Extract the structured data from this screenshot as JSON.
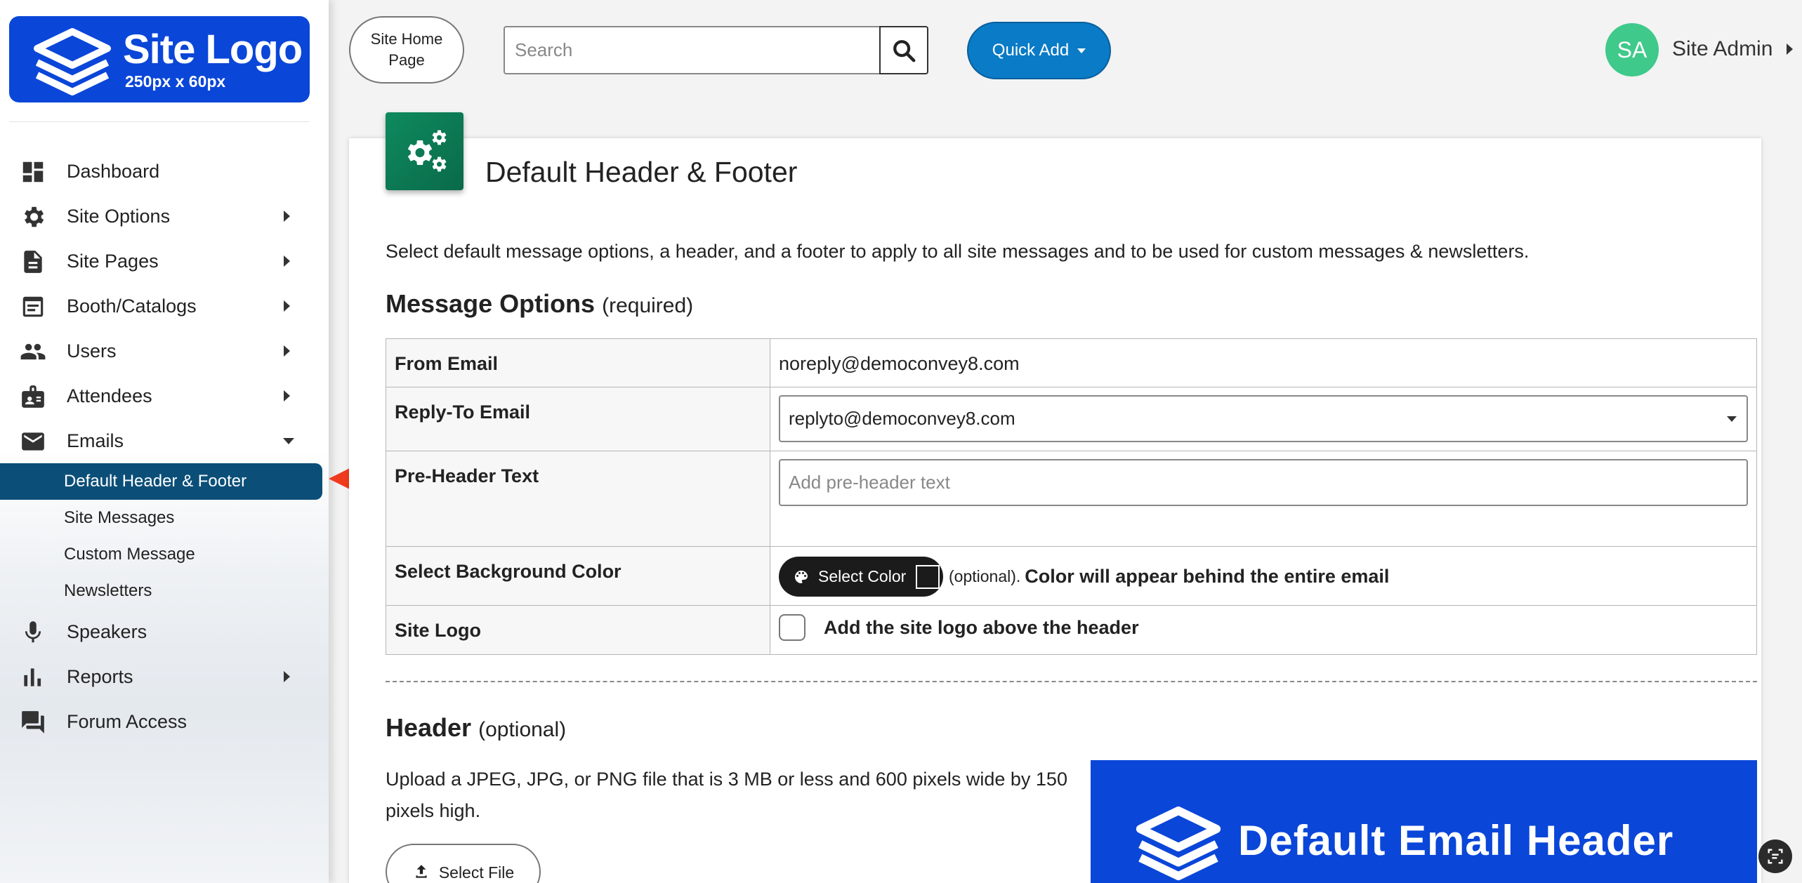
{
  "sidebar": {
    "logo": {
      "title": "Site Logo",
      "subtitle": "250px x 60px"
    },
    "items": [
      {
        "label": "Dashboard",
        "icon": "dashboard-icon"
      },
      {
        "label": "Site Options",
        "icon": "gear-icon"
      },
      {
        "label": "Site Pages",
        "icon": "document-icon"
      },
      {
        "label": "Booth/Catalogs",
        "icon": "catalog-icon"
      },
      {
        "label": "Users",
        "icon": "users-icon"
      },
      {
        "label": "Attendees",
        "icon": "badge-icon"
      },
      {
        "label": "Emails",
        "icon": "mail-icon"
      },
      {
        "label": "Speakers",
        "icon": "microphone-icon"
      },
      {
        "label": "Reports",
        "icon": "bar-chart-icon"
      },
      {
        "label": "Forum Access",
        "icon": "forum-icon"
      }
    ],
    "email_sub": [
      {
        "label": "Default Header & Footer"
      },
      {
        "label": "Site Messages"
      },
      {
        "label": "Custom Message"
      },
      {
        "label": "Newsletters"
      }
    ]
  },
  "topbar": {
    "home_label": "Site Home\nPage",
    "search_placeholder": "Search",
    "quick_add": "Quick Add",
    "avatar_initials": "SA",
    "user_name": "Site Admin"
  },
  "page": {
    "title": "Default Header & Footer",
    "intro": "Select default message options, a header, and a footer to apply to all site messages and to be used for custom messages & newsletters.",
    "options_heading": "Message Options",
    "options_note": "(required)",
    "rows": {
      "from_email_label": "From Email",
      "from_email_value": "noreply@democonvey8.com",
      "reply_to_label": "Reply-To Email",
      "reply_to_value": "replyto@democonvey8.com",
      "preheader_label": "Pre-Header Text",
      "preheader_placeholder": "Add pre-header text",
      "bg_color_label": "Select Background Color",
      "select_color_button": "Select Color",
      "bg_color_note": "(optional).",
      "bg_color_desc": "Color will appear behind the entire email",
      "site_logo_label": "Site Logo",
      "site_logo_checkbox_label": "Add the site logo above the header"
    },
    "header_heading": "Header",
    "header_note": "(optional)",
    "upload_text": "Upload a JPEG, JPG, or PNG file that is 3 MB or less and 600 pixels wide by 150 pixels high.",
    "select_file": "Select File",
    "preview_text": "Default Email Header"
  },
  "colors": {
    "brand_blue": "#0a46d8",
    "active_nav": "#0b4f78",
    "quick_add": "#0a7bc6",
    "avatar": "#3fc98a",
    "page_icon": "#0e8a5f",
    "annotation_arrow": "#f03a1e"
  }
}
